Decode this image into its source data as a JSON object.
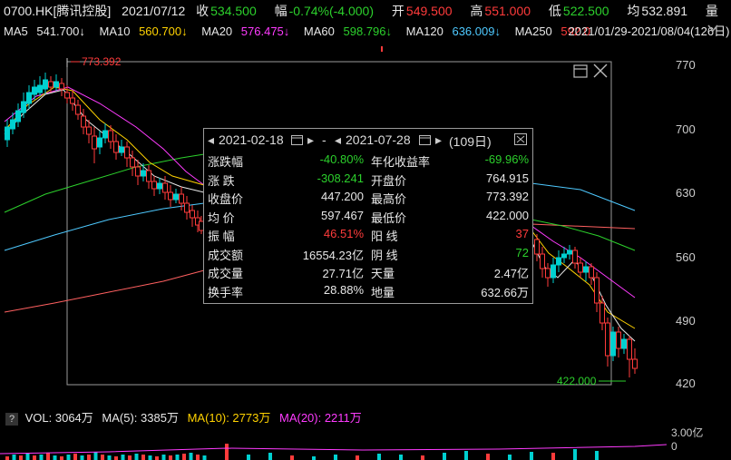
{
  "header": {
    "code_name": "0700.HK[腾讯控股]",
    "date": "2021/07/12",
    "close_label": "收",
    "close_value": "534.500",
    "change_label": "幅",
    "change_value": "-0.74%(-4.000)",
    "open_label": "开",
    "open_value": "549.500",
    "high_label": "高",
    "high_value": "551.000",
    "low_label": "低",
    "low_value": "522.500",
    "avg_label": "均",
    "avg_value": "532.891",
    "vol_label": "量"
  },
  "ma_bar": {
    "ma5_label": "MA5",
    "ma5_value": "541.700↓",
    "ma10_label": "MA10",
    "ma10_value": "560.700↓",
    "ma20_label": "MA20",
    "ma20_value": "576.475↓",
    "ma60_label": "MA60",
    "ma60_value": "598.796↓",
    "ma120_label": "MA120",
    "ma120_value": "636.009↓",
    "ma250_label": "MA250",
    "ma250_value": "592.0",
    "range_text": "2021/01/29-2021/08/04(126日)",
    "dropdown_icon": "chevron-down-icon"
  },
  "colors": {
    "up": "#ff3b3b",
    "down": "#00d0d0",
    "ma5": "#e8e8e8",
    "ma10": "#ffd200",
    "ma20": "#ff3bff",
    "ma60": "#2cd02c",
    "ma120": "#4ec9ff",
    "ma250": "#ff6060"
  },
  "chart": {
    "y_ticks": [
      "770",
      "700",
      "630",
      "560",
      "490",
      "420"
    ],
    "max_marker": "773.392",
    "min_marker": "422.000"
  },
  "panel": {
    "start_date": "2021-02-18",
    "separator": "-",
    "end_date": "2021-07-28",
    "days": "(109日)",
    "rows": [
      {
        "l1": "涨跌幅",
        "v1": "-40.80%",
        "c1": "g",
        "l2": "年化收益率",
        "v2": "-69.96%",
        "c2": "g"
      },
      {
        "l1": "涨    跌",
        "v1": "-308.241",
        "c1": "g",
        "l2": "开盘价",
        "v2": "764.915",
        "c2": "w"
      },
      {
        "l1": "收盘价",
        "v1": "447.200",
        "c1": "w",
        "l2": "最高价",
        "v2": "773.392",
        "c2": "w"
      },
      {
        "l1": "均    价",
        "v1": "597.467",
        "c1": "w",
        "l2": "最低价",
        "v2": "422.000",
        "c2": "w"
      },
      {
        "l1": "振    幅",
        "v1": "46.51%",
        "c1": "r",
        "l2": "阳    线",
        "v2": "37",
        "c2": "r"
      },
      {
        "l1": "成交额",
        "v1": "16554.23亿",
        "c1": "w",
        "l2": "阴    线",
        "v2": "72",
        "c2": "g"
      },
      {
        "l1": "成交量",
        "v1": "27.71亿",
        "c1": "w",
        "l2": "天量",
        "v2": "2.47亿",
        "c2": "w"
      },
      {
        "l1": "换手率",
        "v1": "28.88%",
        "c1": "w",
        "l2": "地量",
        "v2": "632.66万",
        "c2": "w"
      }
    ]
  },
  "volume": {
    "help": "?",
    "vol_label": "VOL: 3064万",
    "ma5_label": "MA(5): 3385万",
    "ma10_label": "MA(10): 2773万",
    "ma20_label": "MA(20): 2211万",
    "axis_top": "3.00亿",
    "axis_bottom": "0"
  }
}
